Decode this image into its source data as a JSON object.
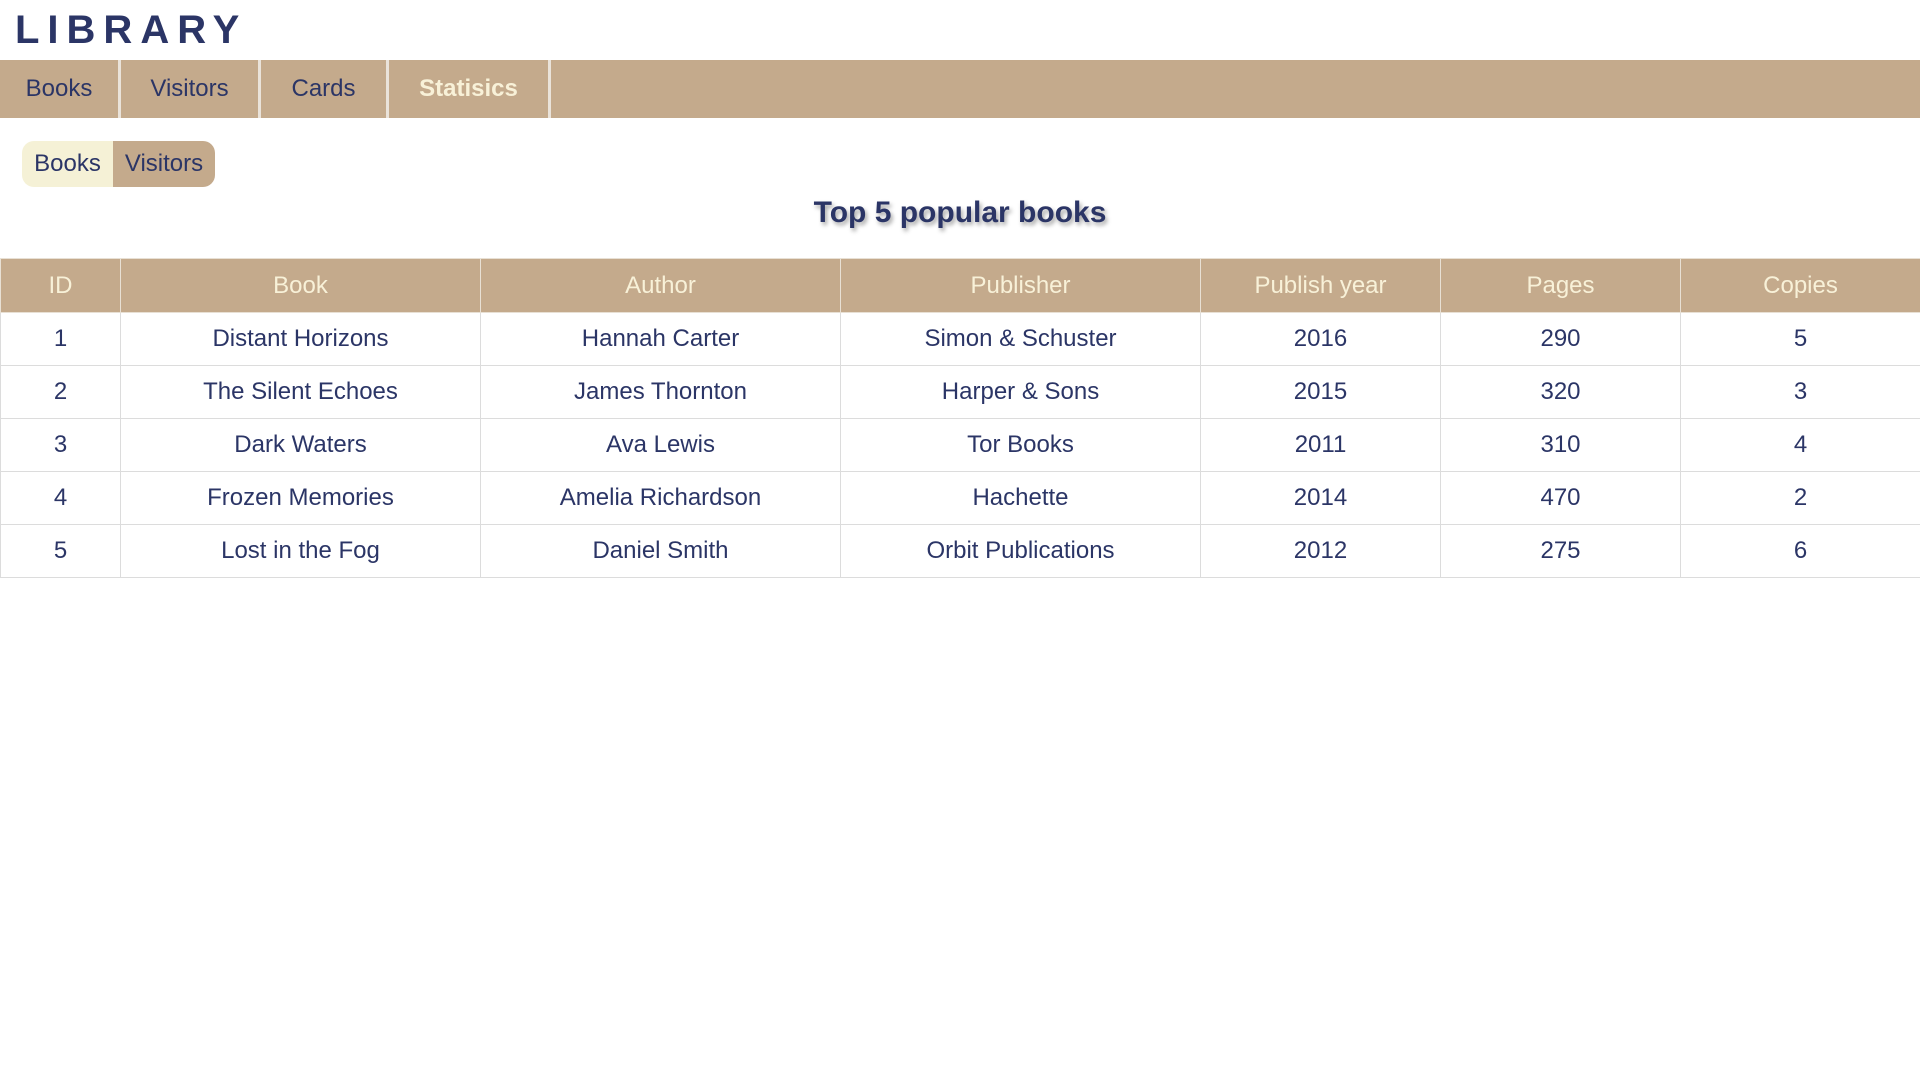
{
  "app": {
    "title": "LIBRARY"
  },
  "nav": {
    "tabs": [
      {
        "label": "Books"
      },
      {
        "label": "Visitors"
      },
      {
        "label": "Cards"
      },
      {
        "label": "Statisics"
      }
    ],
    "active": "Statisics"
  },
  "subtabs": {
    "items": [
      {
        "label": "Books"
      },
      {
        "label": "Visitors"
      }
    ]
  },
  "section": {
    "title": "Top 5 popular books"
  },
  "table": {
    "columns": [
      "ID",
      "Book",
      "Author",
      "Publisher",
      "Publish year",
      "Pages",
      "Copies"
    ],
    "rows": [
      [
        "1",
        "Distant Horizons",
        "Hannah Carter",
        "Simon & Schuster",
        "2016",
        "290",
        "5"
      ],
      [
        "2",
        "The Silent Echoes",
        "James Thornton",
        "Harper & Sons",
        "2015",
        "320",
        "3"
      ],
      [
        "3",
        "Dark Waters",
        "Ava Lewis",
        "Tor Books",
        "2011",
        "310",
        "4"
      ],
      [
        "4",
        "Frozen Memories",
        "Amelia Richardson",
        "Hachette",
        "2014",
        "470",
        "2"
      ],
      [
        "5",
        "Lost in the Fog",
        "Daniel Smith",
        "Orbit Publications",
        "2012",
        "275",
        "6"
      ]
    ]
  },
  "colors": {
    "accent": "#c4aa8c",
    "text": "#2b3566",
    "header_text": "#f8f1d8",
    "subtab_light": "#f5f1d6"
  }
}
